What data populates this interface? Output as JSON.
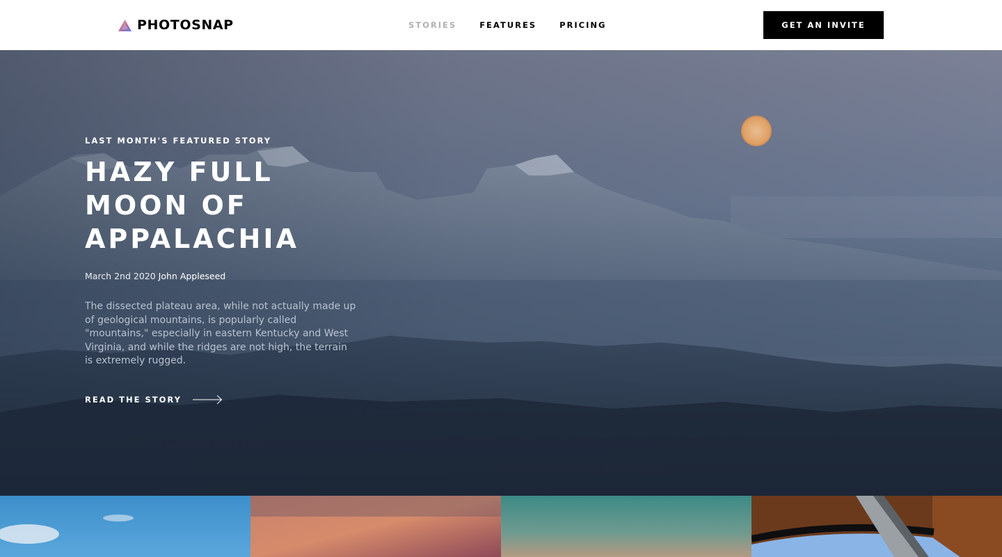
{
  "header": {
    "logo_text": "PHOTOSNAP",
    "nav": [
      {
        "label": "STORIES",
        "active": true
      },
      {
        "label": "FEATURES",
        "active": false
      },
      {
        "label": "PRICING",
        "active": false
      }
    ],
    "invite_label": "GET AN INVITE"
  },
  "hero": {
    "eyebrow": "LAST MONTH'S FEATURED STORY",
    "title": "HAZY FULL MOON OF APPALACHIA",
    "date": "March 2nd 2020",
    "author": "John Appleseed",
    "description": "The dissected plateau area, while not actually made up of geological mountains, is popularly called \"mountains,\" especially in eastern Kentucky and West Virginia, and while the ridges are not high, the terrain is extremely rugged.",
    "cta_label": "READ THE STORY"
  },
  "colors": {
    "nav_muted": "#b0b0b0",
    "button_bg": "#000000",
    "moon": "#f2b879"
  },
  "icons": {
    "logo": "triangle-gradient-icon",
    "cta": "arrow-right-icon"
  }
}
